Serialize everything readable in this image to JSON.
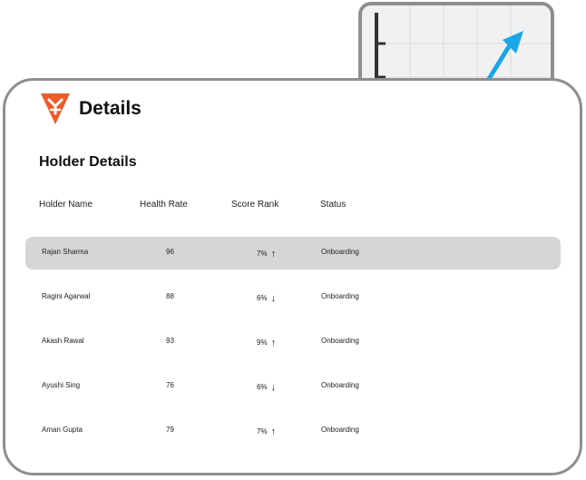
{
  "app": {
    "title": "Details"
  },
  "section": {
    "title": "Holder Details"
  },
  "table": {
    "headers": [
      "Holder Name",
      "Health Rate",
      "Score Rank",
      "Status"
    ],
    "rows": [
      {
        "name": "Rajan Sharma",
        "health": "96",
        "score": "7%",
        "trend": "up",
        "arrow": "↑",
        "status": "Onboarding",
        "selected": true
      },
      {
        "name": "Ragini Agarwal",
        "health": "88",
        "score": "6%",
        "trend": "down",
        "arrow": "↓",
        "status": "Onboarding",
        "selected": false
      },
      {
        "name": "Akash Rawal",
        "health": "93",
        "score": "9%",
        "trend": "up",
        "arrow": "↑",
        "status": "Onboarding",
        "selected": false
      },
      {
        "name": "Ayushi Sing",
        "health": "76",
        "score": "6%",
        "trend": "down",
        "arrow": "↓",
        "status": "Onboarding",
        "selected": false
      },
      {
        "name": "Aman Gupta",
        "health": "79",
        "score": "7%",
        "trend": "up",
        "arrow": "↑",
        "status": "Onboarding",
        "selected": false
      }
    ]
  },
  "colors": {
    "border": "#8e8e8e",
    "selected_row": "#d6d6d6",
    "logo": "#f05a28",
    "blue_series": "#1aa7e8",
    "red_series": "#c8283a",
    "point_blue": "#4a8ad0",
    "point_red": "#e0405a"
  },
  "icons": {
    "logo": "brand-logo-icon",
    "up": "arrow-up-icon",
    "down": "arrow-down-icon"
  }
}
